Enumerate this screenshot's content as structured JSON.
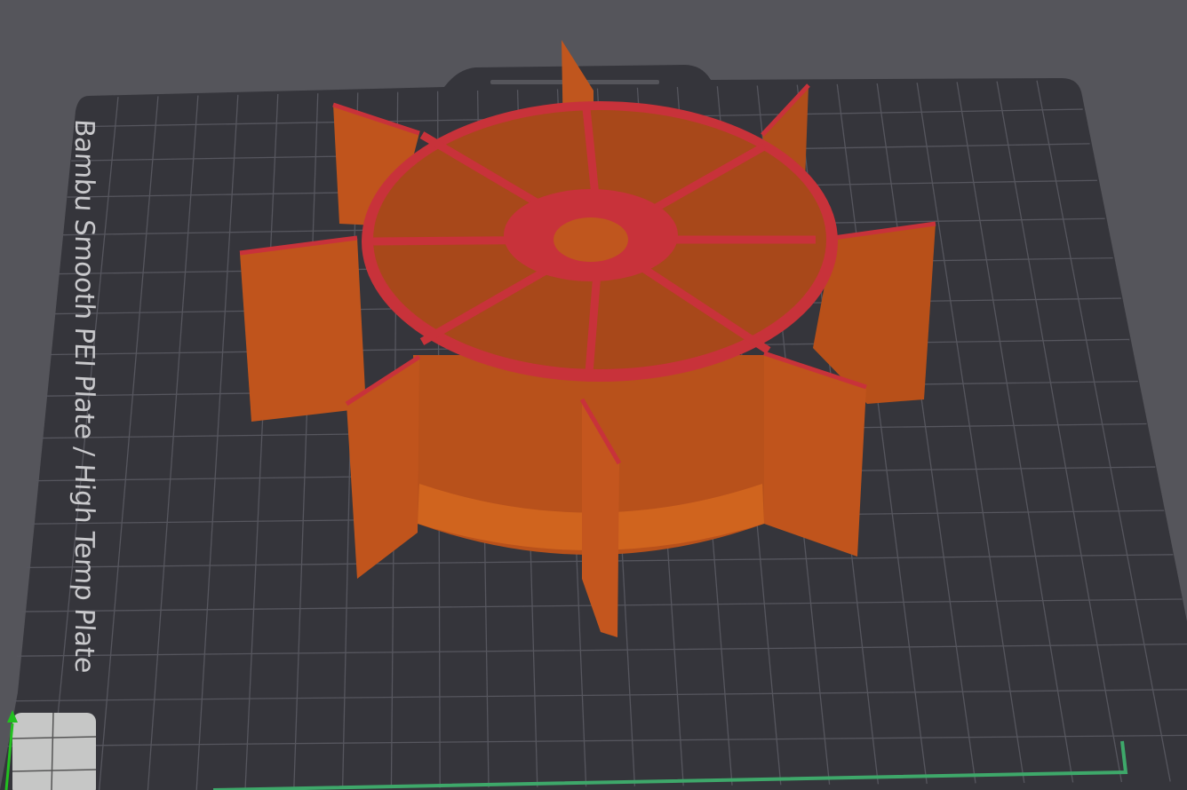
{
  "plate": {
    "label": "Bambu Smooth PEI Plate / High Temp Plate"
  },
  "colors": {
    "background": "#55555b",
    "plate": "#35353b",
    "grid": "#55555d",
    "model_wall": "#c0541c",
    "model_top": "#c8323a",
    "axis_y": "#22c020",
    "bed_boundary": "#3ea86a"
  }
}
